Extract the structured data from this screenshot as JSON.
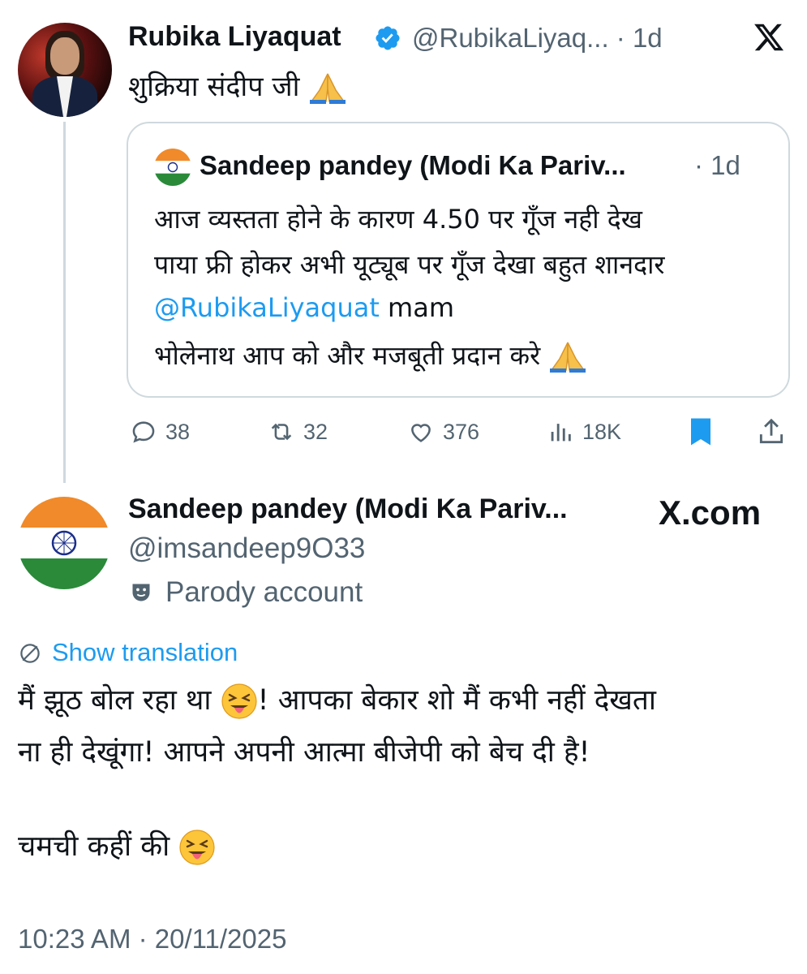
{
  "tweet1": {
    "author_name": "Rubika Liyaquat",
    "handle_time": "@RubikaLiyaq... · 1d",
    "text": "शुक्रिया संदीप जी",
    "quote": {
      "author_name": "Sandeep pandey (Modi Ka Pariv...",
      "time": "· 1d",
      "line1": "आज व्यस्तता होने के कारण 4.50 पर गूँज नही देख",
      "line2": "पाया फ्री होकर अभी यूट्यूब पर गूँज देखा बहुत शानदार",
      "mention": "@RubikaLiyaquat",
      "line3_rest": " mam",
      "line4": "भोलेनाथ आप को और मजबूती प्रदान करे"
    },
    "actions": {
      "replies": "38",
      "reposts": "32",
      "likes": "376",
      "views": "18K"
    }
  },
  "tweet2": {
    "author_name": "Sandeep pandey (Modi Ka Pariv...",
    "site_label": "X.com",
    "handle": "@imsandeep9O33",
    "parody_label": "Parody account",
    "translate_label": "Show translation",
    "line1a": "मैं झूठ बोल रहा था ",
    "line1b": "! आपका बेकार शो मैं कभी नहीं देखता",
    "line2": "ना ही देखूंगा! आपने अपनी आत्मा बीजेपी को बेच दी है!",
    "line3": "चमची कहीं की ",
    "timestamp": "10:23 AM · 20/11/2025"
  },
  "colors": {
    "accent": "#1d9bf0",
    "muted": "#536471",
    "border": "#cfd9de",
    "bookmark": "#1d9bf0"
  },
  "icons": [
    "verified-badge-icon",
    "x-logo-icon",
    "reply-icon",
    "repost-icon",
    "like-icon",
    "views-icon",
    "bookmark-icon",
    "share-icon",
    "parody-mask-icon",
    "translate-globe-icon",
    "folded-hands-emoji",
    "tongue-face-emoji"
  ]
}
